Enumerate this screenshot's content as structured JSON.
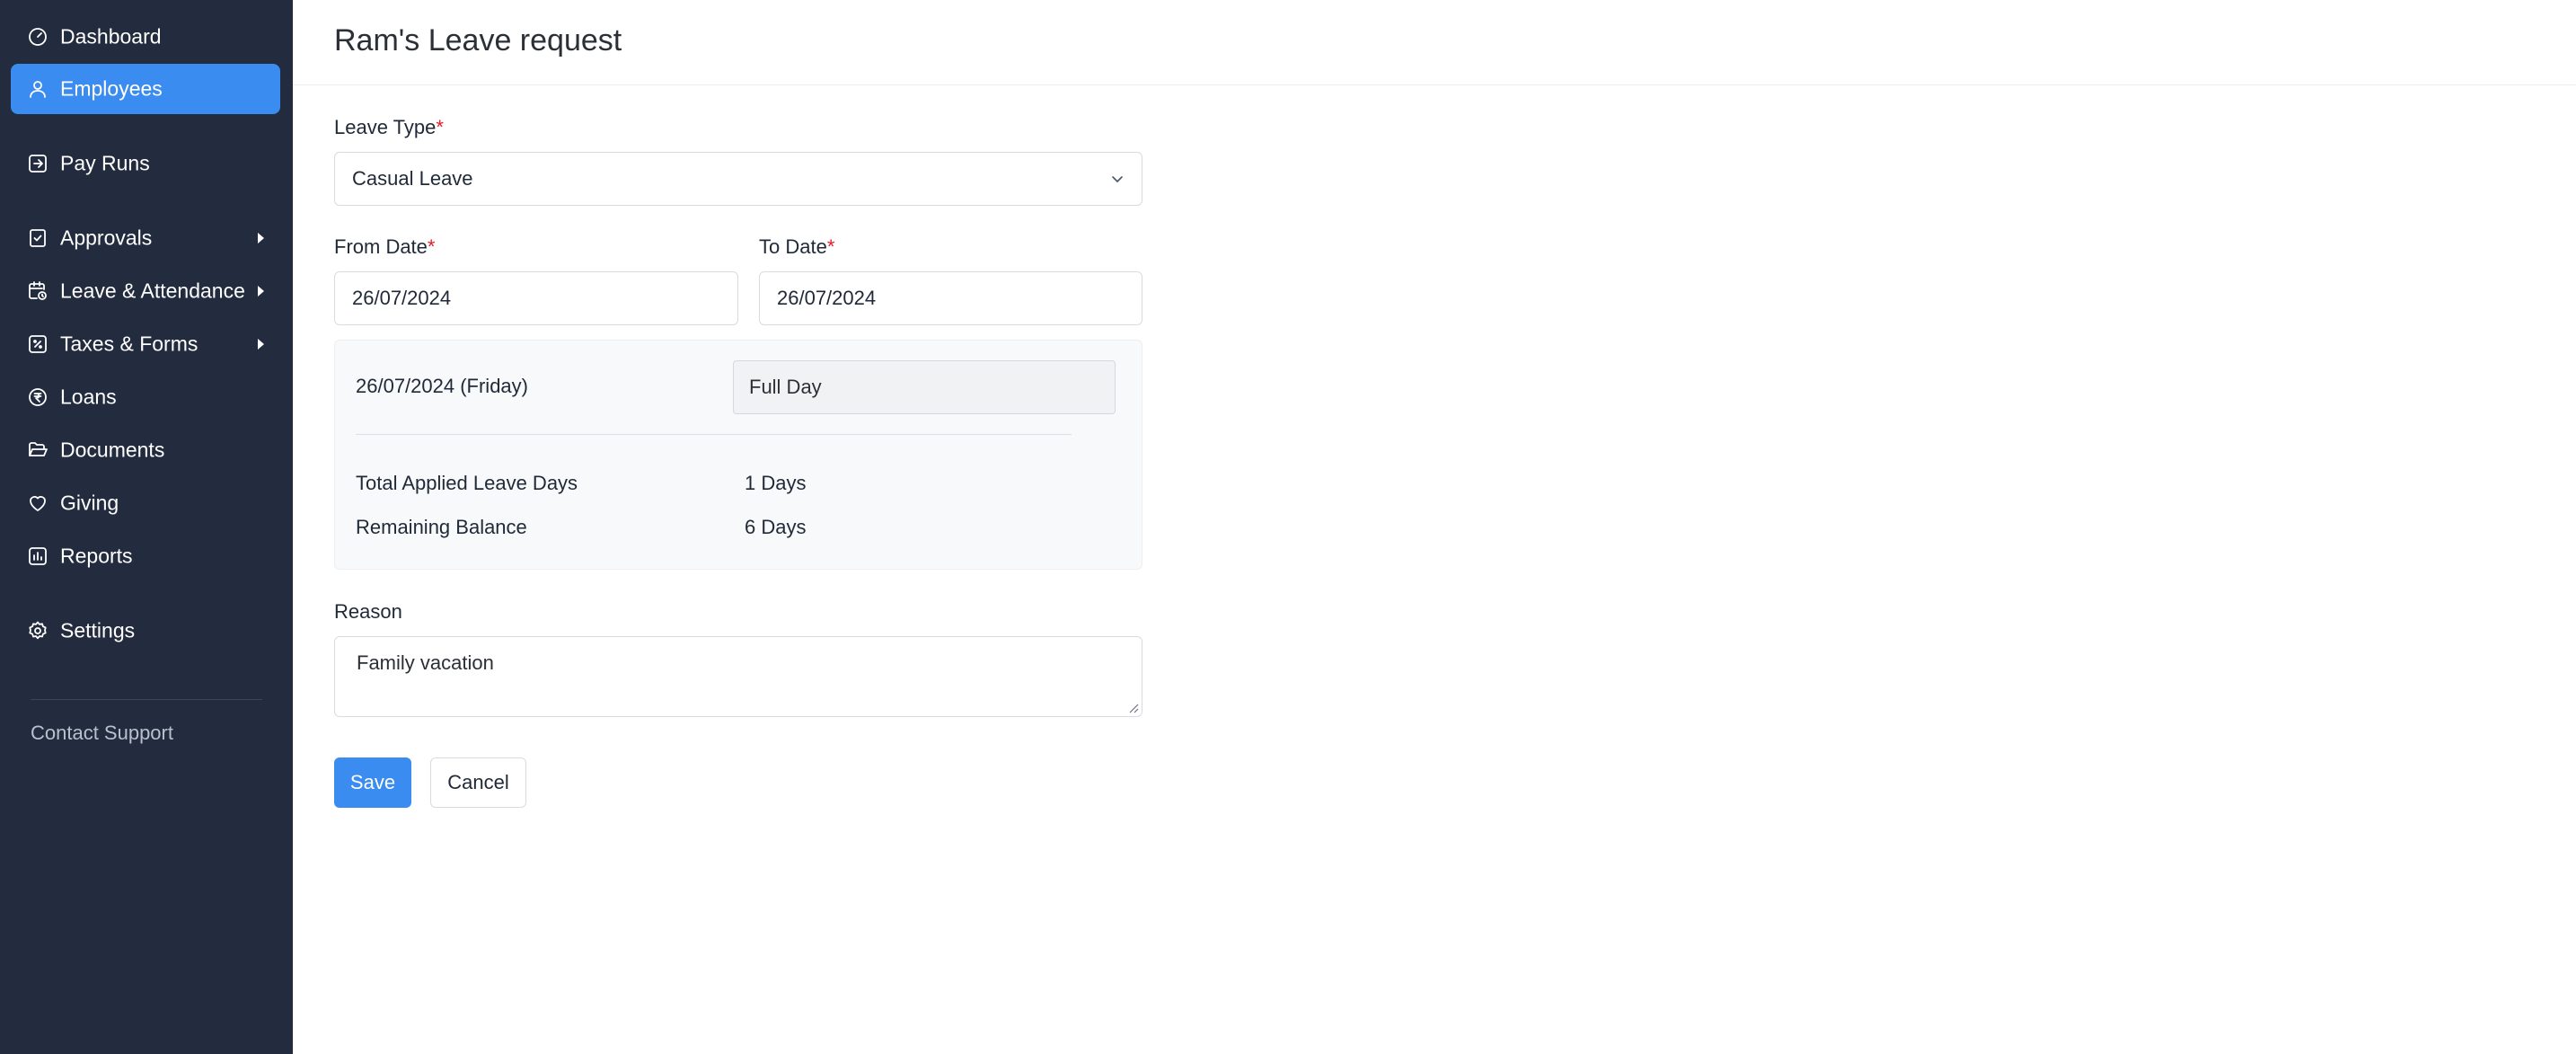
{
  "sidebar": {
    "items": [
      {
        "label": "Dashboard",
        "icon": "dashboard-icon",
        "active": false,
        "has_submenu": false
      },
      {
        "label": "Employees",
        "icon": "user-icon",
        "active": true,
        "has_submenu": false
      },
      {
        "label": "Pay Runs",
        "icon": "pay-runs-icon",
        "active": false,
        "has_submenu": false
      },
      {
        "label": "Approvals",
        "icon": "check-square-icon",
        "active": false,
        "has_submenu": true
      },
      {
        "label": "Leave & Attendance",
        "icon": "calendar-clock-icon",
        "active": false,
        "has_submenu": true
      },
      {
        "label": "Taxes & Forms",
        "icon": "percent-icon",
        "active": false,
        "has_submenu": true
      },
      {
        "label": "Loans",
        "icon": "rupee-icon",
        "active": false,
        "has_submenu": false
      },
      {
        "label": "Documents",
        "icon": "folder-icon",
        "active": false,
        "has_submenu": false
      },
      {
        "label": "Giving",
        "icon": "heart-icon",
        "active": false,
        "has_submenu": false
      },
      {
        "label": "Reports",
        "icon": "bar-chart-icon",
        "active": false,
        "has_submenu": false
      },
      {
        "label": "Settings",
        "icon": "gear-icon",
        "active": false,
        "has_submenu": false
      }
    ],
    "support_label": "Contact Support"
  },
  "page": {
    "title": "Ram's Leave request"
  },
  "form": {
    "leave_type": {
      "label": "Leave Type",
      "required_mark": "*",
      "value": "Casual Leave"
    },
    "from_date": {
      "label": "From Date",
      "required_mark": "*",
      "value": "26/07/2024"
    },
    "to_date": {
      "label": "To Date",
      "required_mark": "*",
      "value": "26/07/2024"
    },
    "summary": {
      "date": "26/07/2024 (Friday)",
      "day_type": "Full Day",
      "total_label": "Total Applied Leave Days",
      "total_value": "1 Days",
      "remaining_label": "Remaining Balance",
      "remaining_value": "6 Days"
    },
    "reason": {
      "label": "Reason",
      "value": "Family vacation"
    },
    "save_label": "Save",
    "cancel_label": "Cancel"
  },
  "colors": {
    "sidebar_bg": "#232b3e",
    "accent": "#3b8cf0",
    "required": "#e11d2a"
  }
}
